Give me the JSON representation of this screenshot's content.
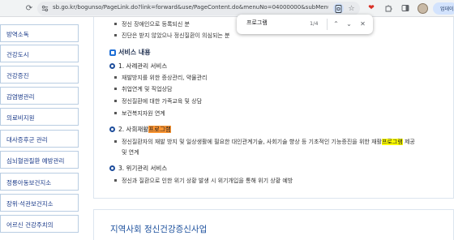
{
  "browser": {
    "url": "sb.go.kr/bogunso/PageLink.do?link=forward&use/PageContent.do&menuNo=04000000&subMenuNo=04050000&thirdMe...",
    "relaunch_label": "업데이트"
  },
  "findbar": {
    "query": "프로그램",
    "count": "1/4"
  },
  "sidebar": {
    "items": [
      {
        "label": "방역소독"
      },
      {
        "label": "건강도시"
      },
      {
        "label": "건강증진"
      },
      {
        "label": "감염병관리"
      },
      {
        "label": "의료비지원"
      },
      {
        "label": "대사증후군 관리"
      },
      {
        "label": "심뇌혈관질환 예방관리"
      },
      {
        "label": "정릉아동보건지소"
      },
      {
        "label": "장위·석관보건지소"
      },
      {
        "label": "어르신 건강주치의"
      }
    ]
  },
  "content": {
    "top_bullets": [
      "정신 장애인으로 등록되신 분",
      "진단은 받지 않았으나 정신질환이 의심되는 분"
    ],
    "service_title": "서비스 내용",
    "section1": {
      "title": "1. 사례관리 서비스",
      "bullets": [
        "재발방지를 위한 증상관리, 약물관리",
        "취업연계 및 직업상담",
        "정신질환에 대한 가족교육 및 상담",
        "보건복지자원 연계"
      ]
    },
    "section2": {
      "title_prefix": "2. 사회재활",
      "title_highlight": "프로그램",
      "desc_line1_prefix": "정신질환자의 재발 방지 및 일상생활에 필요한 대인관계기술, 사회기술 향상 등 기초적인 기능증진을 위한 재활",
      "desc_line1_highlight": "프로그램",
      "desc_line1_suffix": " 제공",
      "desc_line2": "및 연계"
    },
    "section3": {
      "title": "3. 위기관리 서비스",
      "bullets": [
        "정신과 질환으로 인한 위기 상황 발생 시 위기개입을 통해 위기 상황 예방"
      ]
    },
    "next_title": "지역사회 정신건강증신사업"
  }
}
